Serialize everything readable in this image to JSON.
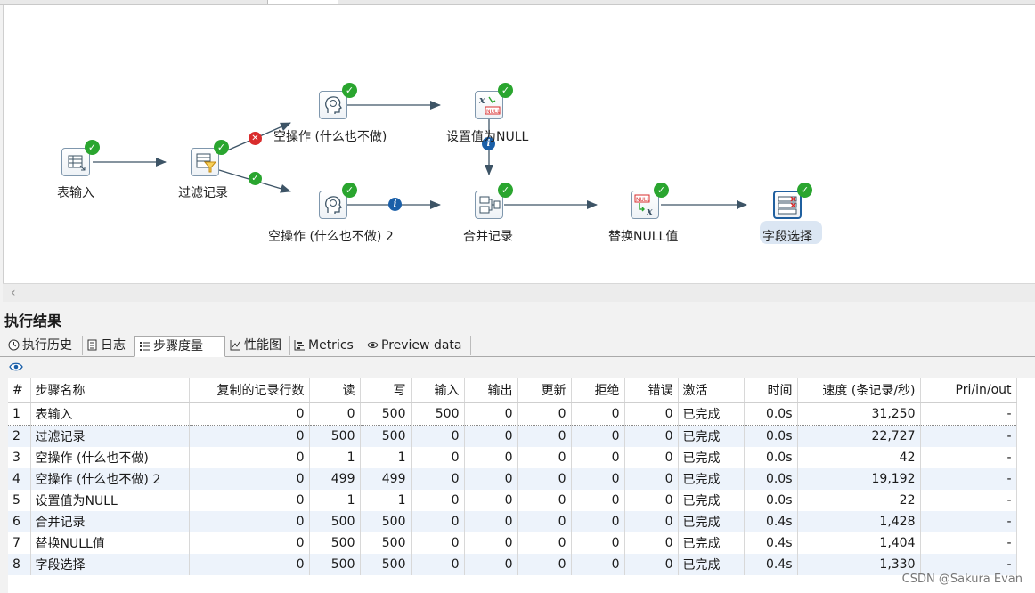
{
  "canvas": {
    "steps": [
      {
        "label": "表输入",
        "icon": "table-input-icon"
      },
      {
        "label": "过滤记录",
        "icon": "filter-rows-icon"
      },
      {
        "label": "空操作 (什么也不做)",
        "icon": "dummy-head-icon"
      },
      {
        "label": "设置值为NULL",
        "icon": "set-null-icon"
      },
      {
        "label": "空操作 (什么也不做) 2",
        "icon": "dummy-head-icon"
      },
      {
        "label": "合并记录",
        "icon": "merge-rows-icon"
      },
      {
        "label": "替换NULL值",
        "icon": "replace-null-icon"
      },
      {
        "label": "字段选择",
        "icon": "select-values-icon"
      }
    ],
    "icon_text": {
      "null_badge": "NULL",
      "x_glyph": "x"
    }
  },
  "results": {
    "title": "执行结果",
    "tabs": [
      {
        "label": "执行历史",
        "icon": "clock-icon"
      },
      {
        "label": "日志",
        "icon": "log-icon"
      },
      {
        "label": "步骤度量",
        "icon": "list-icon"
      },
      {
        "label": "性能图",
        "icon": "line-chart-icon"
      },
      {
        "label": "Metrics",
        "icon": "metrics-icon"
      },
      {
        "label": "Preview data",
        "icon": "eye-icon"
      }
    ],
    "active_tab": "步骤度量",
    "columns": [
      "#",
      "步骤名称",
      "复制的记录行数",
      "读",
      "写",
      "输入",
      "输出",
      "更新",
      "拒绝",
      "错误",
      "激活",
      "时间",
      "速度 (条记录/秒)",
      "Pri/in/out"
    ],
    "rows": [
      [
        "1",
        "表输入",
        "0",
        "0",
        "500",
        "500",
        "0",
        "0",
        "0",
        "0",
        "已完成",
        "0.0s",
        "31,250",
        "-"
      ],
      [
        "2",
        "过滤记录",
        "0",
        "500",
        "500",
        "0",
        "0",
        "0",
        "0",
        "0",
        "已完成",
        "0.0s",
        "22,727",
        "-"
      ],
      [
        "3",
        "空操作 (什么也不做)",
        "0",
        "1",
        "1",
        "0",
        "0",
        "0",
        "0",
        "0",
        "已完成",
        "0.0s",
        "42",
        "-"
      ],
      [
        "4",
        "空操作 (什么也不做) 2",
        "0",
        "499",
        "499",
        "0",
        "0",
        "0",
        "0",
        "0",
        "已完成",
        "0.0s",
        "19,192",
        "-"
      ],
      [
        "5",
        "设置值为NULL",
        "0",
        "1",
        "1",
        "0",
        "0",
        "0",
        "0",
        "0",
        "已完成",
        "0.0s",
        "22",
        "-"
      ],
      [
        "6",
        "合并记录",
        "0",
        "500",
        "500",
        "0",
        "0",
        "0",
        "0",
        "0",
        "已完成",
        "0.4s",
        "1,428",
        "-"
      ],
      [
        "7",
        "替换NULL值",
        "0",
        "500",
        "500",
        "0",
        "0",
        "0",
        "0",
        "0",
        "已完成",
        "0.4s",
        "1,404",
        "-"
      ],
      [
        "8",
        "字段选择",
        "0",
        "500",
        "500",
        "0",
        "0",
        "0",
        "0",
        "0",
        "已完成",
        "0.4s",
        "1,330",
        "-"
      ]
    ]
  },
  "watermark": "CSDN @Sakura Evan",
  "colors": {
    "success": "#2aa52f",
    "error": "#d92c2c",
    "info": "#1a5fa8",
    "hop": "#3d5466",
    "row_alt": "#edf3fb"
  }
}
